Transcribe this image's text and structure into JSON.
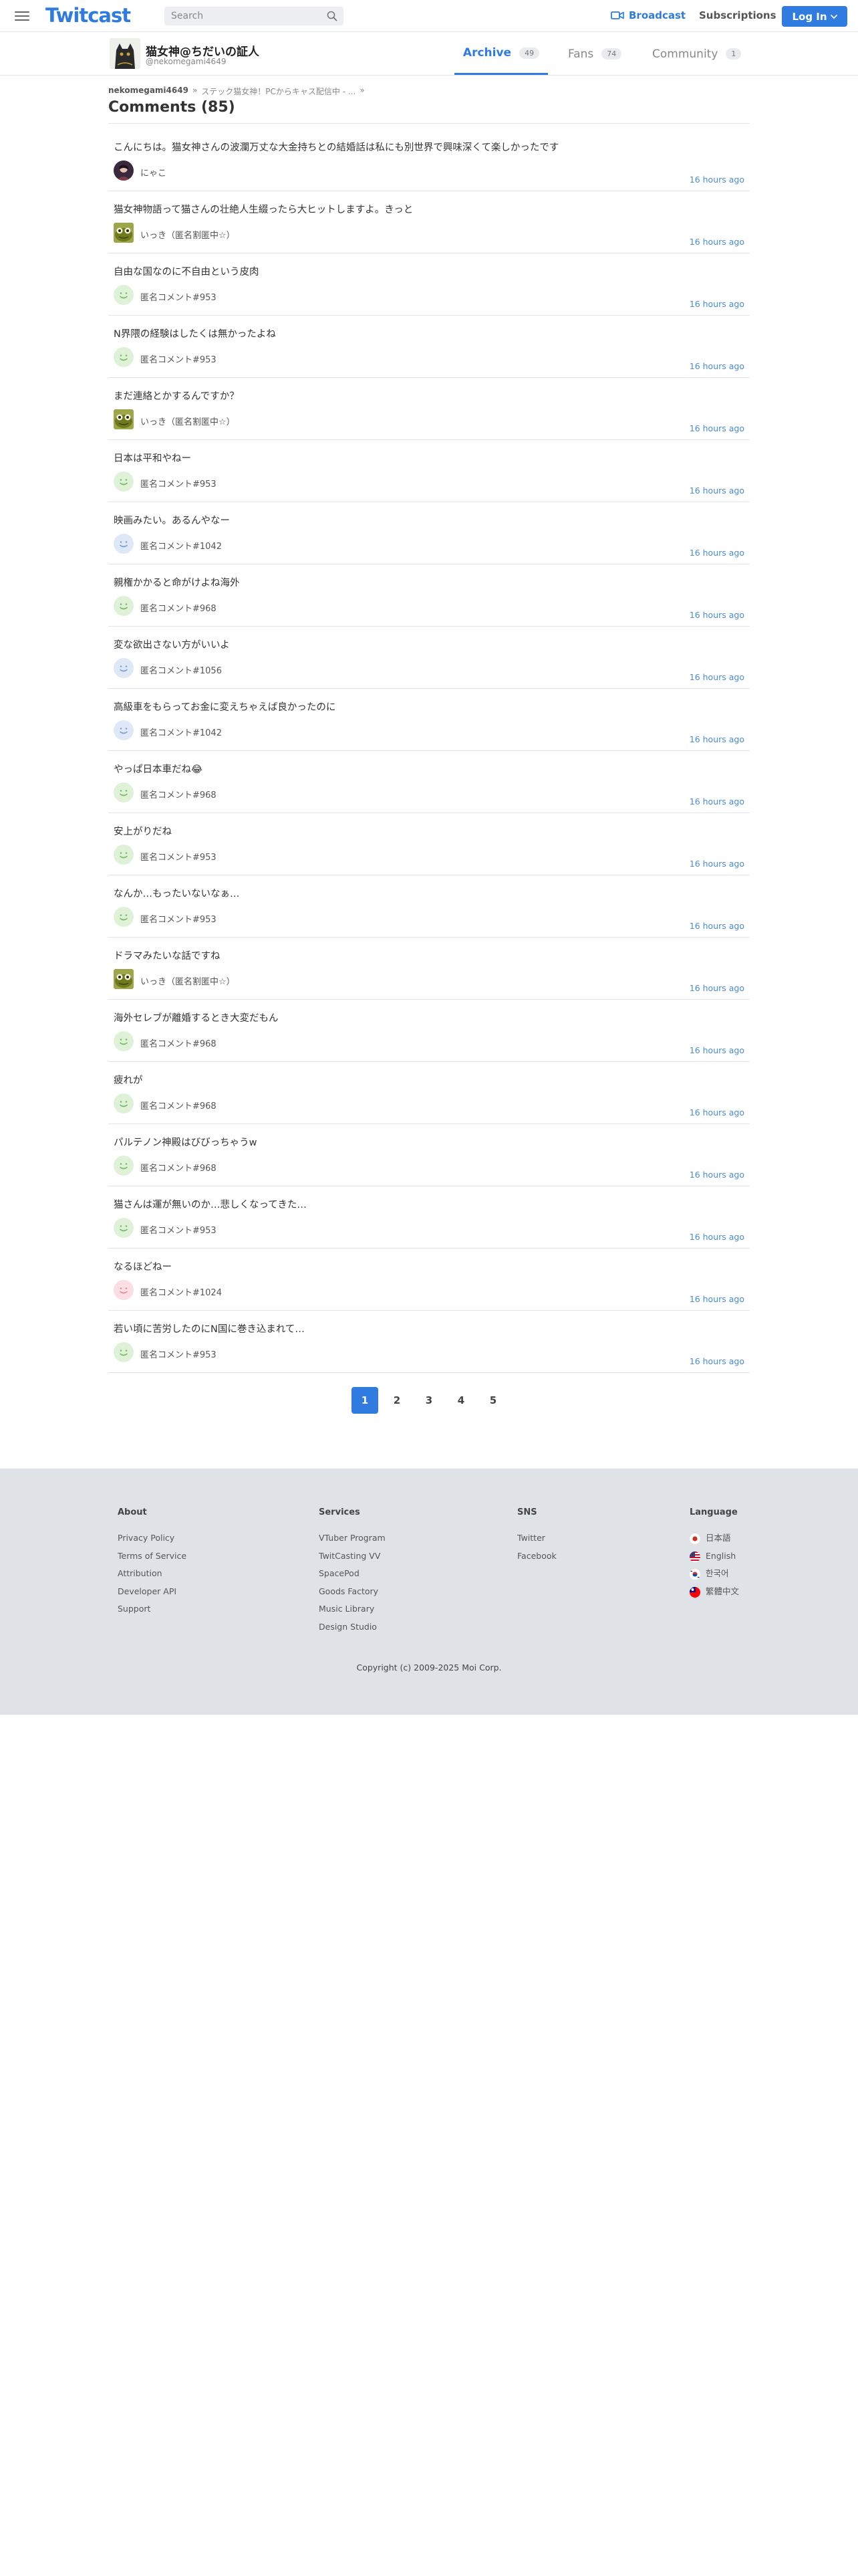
{
  "header": {
    "logo": "Twitcast",
    "search_placeholder": "Search",
    "broadcast_label": "Broadcast",
    "subscriptions_label": "Subscriptions",
    "login_label": "Log In",
    "brand_color": "#2f7be0"
  },
  "channel": {
    "name": "猫女神@ちだいの証人",
    "id": "@nekomegami4649",
    "tabs": [
      {
        "label": "Archive",
        "count": "49"
      },
      {
        "label": "Fans",
        "count": "74"
      },
      {
        "label": "Community",
        "count": "1"
      }
    ]
  },
  "breadcrumb": {
    "user": "nekomegami4649",
    "sep1": "»",
    "item": "ステック猫女神！PCからキャス配信中 - ...",
    "sep2": "»"
  },
  "page_title": "Comments (85)",
  "comments": [
    {
      "text": "こんにちは。猫女神さんの波瀾万丈な大金持ちとの結婚話は私にも別世界で興味深くて楽しかったです",
      "user": "にゃこ",
      "time": "16 hours ago"
    },
    {
      "text": "猫女神物語って猫さんの壮絶人生綴ったら大ヒットしますよ。きっと",
      "user": "いっき（匿名割匿中☆）",
      "time": "16 hours ago"
    },
    {
      "text": "自由な国なのに不自由という皮肉",
      "user": "匿名コメント#953",
      "time": "16 hours ago"
    },
    {
      "text": "N界隈の経験はしたくは無かったよね",
      "user": "匿名コメント#953",
      "time": "16 hours ago"
    },
    {
      "text": "まだ連絡とかするんですか？",
      "user": "いっき（匿名割匿中☆）",
      "time": "16 hours ago"
    },
    {
      "text": "日本は平和やねー",
      "user": "匿名コメント#953",
      "time": "16 hours ago"
    },
    {
      "text": "映画みたい。あるんやなー",
      "user": "匿名コメント#1042",
      "time": "16 hours ago"
    },
    {
      "text": "親権かかると命がけよね海外",
      "user": "匿名コメント#968",
      "time": "16 hours ago"
    },
    {
      "text": "変な欲出さない方がいいよ",
      "user": "匿名コメント#1056",
      "time": "16 hours ago"
    },
    {
      "text": "高級車をもらってお金に変えちゃえば良かったのに",
      "user": "匿名コメント#1042",
      "time": "16 hours ago"
    },
    {
      "text": "やっぱ日本車だね😂",
      "user": "匿名コメント#968",
      "time": "16 hours ago"
    },
    {
      "text": "安上がりだね󠄀",
      "user": "匿名コメント#953",
      "time": "16 hours ago"
    },
    {
      "text": "なんか…もったいないなぁ…",
      "user": "匿名コメント#953",
      "time": "16 hours ago"
    },
    {
      "text": "ドラマみたいな話ですね",
      "user": "いっき（匿名割匿中☆）",
      "time": "16 hours ago"
    },
    {
      "text": "海外セレブが離婚するとき大変だもん",
      "user": "匿名コメント#968",
      "time": "16 hours ago"
    },
    {
      "text": "疲れが󠄀",
      "user": "匿名コメント#968",
      "time": "16 hours ago"
    },
    {
      "text": "パルテノン神殿はびびっちゃうw",
      "user": "匿名コメント#968",
      "time": "16 hours ago"
    },
    {
      "text": "猫さんは運が無いのか…悲しくなってきた…",
      "user": "匿名コメント#953",
      "time": "16 hours ago"
    },
    {
      "text": "なるほどねー",
      "user": "匿名コメント#1024",
      "time": "16 hours ago"
    },
    {
      "text": "若い頃に苦労したのにN国に巻き込まれて…",
      "user": "匿名コメント#953",
      "time": "16 hours ago"
    }
  ],
  "pagination": [
    "1",
    "2",
    "3",
    "4",
    "5"
  ],
  "footer": {
    "about": {
      "title": "About",
      "links": [
        "Privacy Policy",
        "Terms of Service",
        "Attribution",
        "Developer API",
        "Support"
      ]
    },
    "services": {
      "title": "Services",
      "links": [
        "VTuber Program",
        "TwitCasting VV",
        "SpacePod",
        "Goods Factory",
        "Music Library",
        "Design Studio"
      ]
    },
    "sns": {
      "title": "SNS",
      "links": [
        "Twitter",
        "Facebook"
      ]
    },
    "language": {
      "title": "Language",
      "links": [
        "日本語",
        "English",
        "한국어",
        "繁體中文"
      ]
    },
    "copyright": "Copyright (c) 2009-2025 Moi Corp."
  }
}
